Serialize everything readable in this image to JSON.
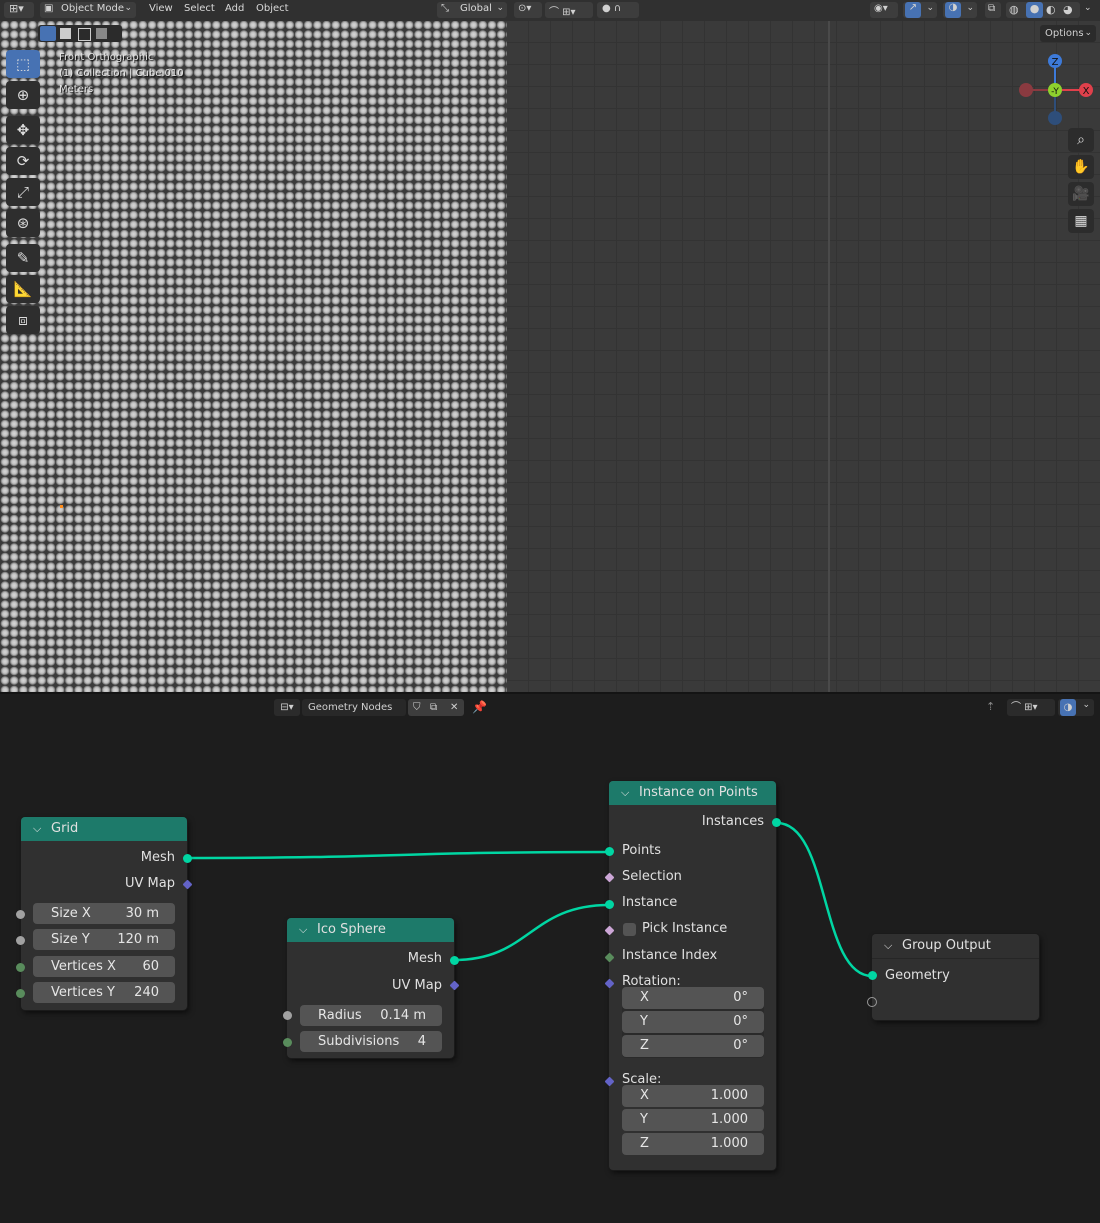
{
  "viewport": {
    "header": {
      "mode": "Object Mode",
      "menus": [
        "View",
        "Select",
        "Add",
        "Object"
      ],
      "orientation": "Global",
      "options_label": "Options"
    },
    "overlay": {
      "view_name": "Front Orthographic",
      "collection": "(1) Collection | Cube.010",
      "units": "Meters"
    },
    "gizmo": {
      "z": "Z",
      "y": "-Y",
      "x": "X"
    },
    "tools": [
      "select-box-icon",
      "cursor-icon",
      "move-icon",
      "rotate-icon",
      "scale-icon",
      "transform-icon",
      "annotate-icon",
      "measure-icon",
      "add-cube-icon"
    ],
    "nav_buttons": [
      "zoom-icon",
      "pan-hand-icon",
      "camera-icon",
      "grid-ortho-icon"
    ]
  },
  "node_editor": {
    "header": {
      "tree_name": "Geometry Nodes"
    },
    "nodes": {
      "grid": {
        "title": "Grid",
        "outputs": [
          "Mesh",
          "UV Map"
        ],
        "fields": [
          {
            "label": "Size X",
            "value": "30 m"
          },
          {
            "label": "Size Y",
            "value": "120 m"
          },
          {
            "label": "Vertices X",
            "value": "60"
          },
          {
            "label": "Vertices Y",
            "value": "240"
          }
        ]
      },
      "ico_sphere": {
        "title": "Ico Sphere",
        "outputs": [
          "Mesh",
          "UV Map"
        ],
        "fields": [
          {
            "label": "Radius",
            "value": "0.14 m"
          },
          {
            "label": "Subdivisions",
            "value": "4"
          }
        ]
      },
      "instance_on_points": {
        "title": "Instance on Points",
        "output": "Instances",
        "inputs": [
          "Points",
          "Selection",
          "Instance",
          "Pick Instance",
          "Instance Index",
          "Rotation:",
          "Scale:"
        ],
        "rotation": [
          {
            "axis": "X",
            "value": "0°"
          },
          {
            "axis": "Y",
            "value": "0°"
          },
          {
            "axis": "Z",
            "value": "0°"
          }
        ],
        "scale": [
          {
            "axis": "X",
            "value": "1.000"
          },
          {
            "axis": "Y",
            "value": "1.000"
          },
          {
            "axis": "Z",
            "value": "1.000"
          }
        ]
      },
      "group_output": {
        "title": "Group Output",
        "inputs": [
          "Geometry"
        ]
      }
    }
  }
}
